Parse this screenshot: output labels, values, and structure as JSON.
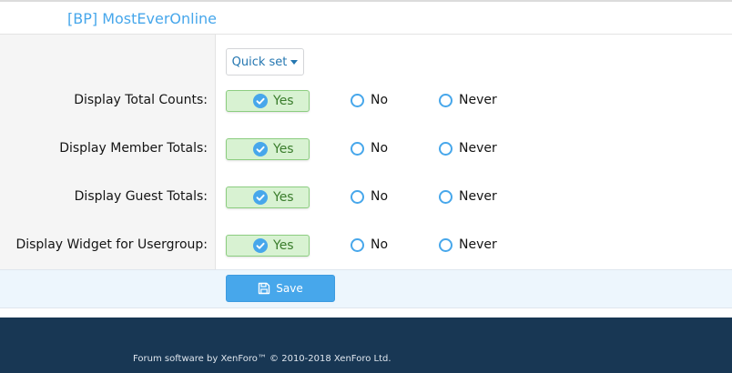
{
  "header": {
    "title": "[BP] MostEverOnline"
  },
  "quick_set": {
    "label": "Quick set"
  },
  "options": {
    "yes": "Yes",
    "no": "No",
    "never": "Never"
  },
  "rows": [
    {
      "label": "Display Total Counts:",
      "selected": "Yes"
    },
    {
      "label": "Display Member Totals:",
      "selected": "Yes"
    },
    {
      "label": "Display Guest Totals:",
      "selected": "Yes"
    },
    {
      "label": "Display Widget for Usergroup:",
      "selected": "Yes"
    }
  ],
  "submit": {
    "save_label": "Save"
  },
  "footer": {
    "copyright": "Forum software by XenForo™ © 2010-2018 XenForo Ltd."
  },
  "colors": {
    "accent": "#47a7eb",
    "selected_bg": "#d8f2d2",
    "selected_border": "#8ccd80",
    "footer_bg": "#183754"
  }
}
